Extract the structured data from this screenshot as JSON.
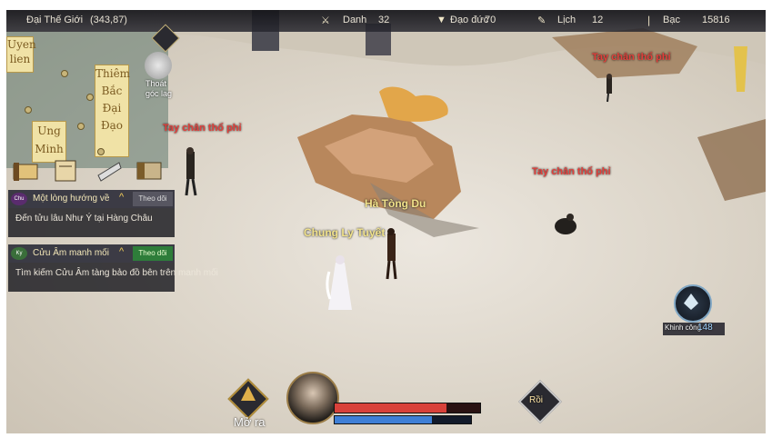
{
  "topbar": {
    "location": "Đại Thế Giới",
    "coords": "(343,87)",
    "stats": [
      {
        "icon": "sword-icon",
        "label": "Danh",
        "value": "32"
      },
      {
        "icon": "cup-icon",
        "label": "Đạo đức",
        "value": "70"
      },
      {
        "icon": "lich-icon",
        "label": "Lịch",
        "value": "12"
      },
      {
        "icon": "coin-icon",
        "label": "Bạc",
        "value": "15816"
      }
    ]
  },
  "minimap": {
    "labels": [
      "Uyen\nlien",
      "Thiêm\nBắc\nĐại\nĐạo",
      "Ung\nMinh"
    ],
    "exit_label": "Thoát\ngóc lag"
  },
  "quests": [
    {
      "tag": "Chu",
      "title": "Một lòng hướng về",
      "follow": "Theo dõi",
      "desc": "Đến tửu lâu Như Ý tại Hàng Châu"
    },
    {
      "tag": "Ky",
      "title": "Cửu Âm manh mối",
      "follow": "Theo dõi",
      "desc": "Tìm kiếm Cửu Âm tàng bảo đồ bên trên manh mối"
    }
  ],
  "names": {
    "bandit": "Tay chân thổ phỉ",
    "player_male": "Hà Tòng Du",
    "player_female": "Chung Ly Tuyết"
  },
  "hud": {
    "open_label": "Mở ra",
    "action_label": "Rồi",
    "hp_ratio": 0.78,
    "mp_ratio": 0.72,
    "event_label": "Khinh công",
    "event_value": "148"
  },
  "colors": {
    "hp": "#d8413a",
    "mp": "#3f7fd6",
    "bandit": "#e2403c",
    "player": "#f1e28b"
  }
}
